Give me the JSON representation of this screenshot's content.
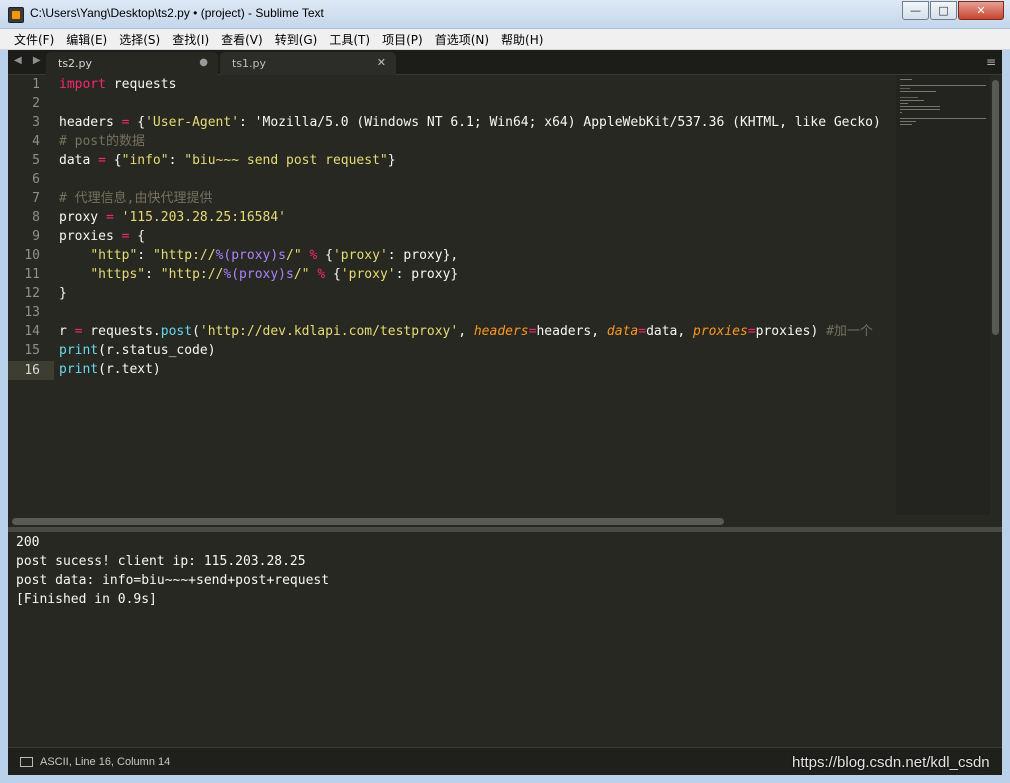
{
  "window": {
    "title": "C:\\Users\\Yang\\Desktop\\ts2.py • (project) - Sublime Text",
    "controls": {
      "minimize": "—",
      "maximize": "□",
      "close": "✕"
    }
  },
  "menu": [
    "文件(F)",
    "编辑(E)",
    "选择(S)",
    "查找(I)",
    "查看(V)",
    "转到(G)",
    "工具(T)",
    "项目(P)",
    "首选项(N)",
    "帮助(H)"
  ],
  "tabs": [
    {
      "label": "ts2.py",
      "active": true,
      "dirty": true
    },
    {
      "label": "ts1.py",
      "active": false,
      "dirty": false
    }
  ],
  "tabbar": {
    "nav_arrows": "◀ ▶",
    "dirty_mark": "●",
    "close_mark": "✕",
    "menu_icon": "≡"
  },
  "editor": {
    "line_numbers": [
      "1",
      "2",
      "3",
      "4",
      "5",
      "6",
      "7",
      "8",
      "9",
      "10",
      "11",
      "12",
      "13",
      "14",
      "15",
      "16"
    ],
    "current_line": 16,
    "lines": [
      "import requests",
      "",
      "headers = {'User-Agent': 'Mozilla/5.0 (Windows NT 6.1; Win64; x64) AppleWebKit/537.36 (KHTML, like Gecko)",
      "# post的数据",
      "data = {\"info\": \"biu~~~ send post request\"}",
      "",
      "# 代理信息,由快代理提供",
      "proxy = '115.203.28.25:16584'",
      "proxies = {",
      "    \"http\": \"http://%(proxy)s/\" % {'proxy': proxy},",
      "    \"https\": \"http://%(proxy)s/\" % {'proxy': proxy}",
      "}",
      "",
      "r = requests.post('http://dev.kdlapi.com/testproxy', headers=headers, data=data, proxies=proxies) #加一个",
      "print(r.status_code)",
      "print(r.text)"
    ]
  },
  "output": {
    "lines": [
      "200",
      "post sucess! client ip: 115.203.28.25",
      "post data: info=biu~~~+send+post+request",
      "[Finished in 0.9s]"
    ]
  },
  "status": {
    "text": "ASCII, Line 16, Column 14"
  },
  "watermark": "https://blog.csdn.net/kdl_csdn",
  "theme": {
    "background": "#272822",
    "keyword": "#f92672",
    "function": "#66d9ef",
    "string": "#e6db74",
    "comment": "#75715e",
    "number": "#ae81ff",
    "argument": "#fd971f"
  }
}
